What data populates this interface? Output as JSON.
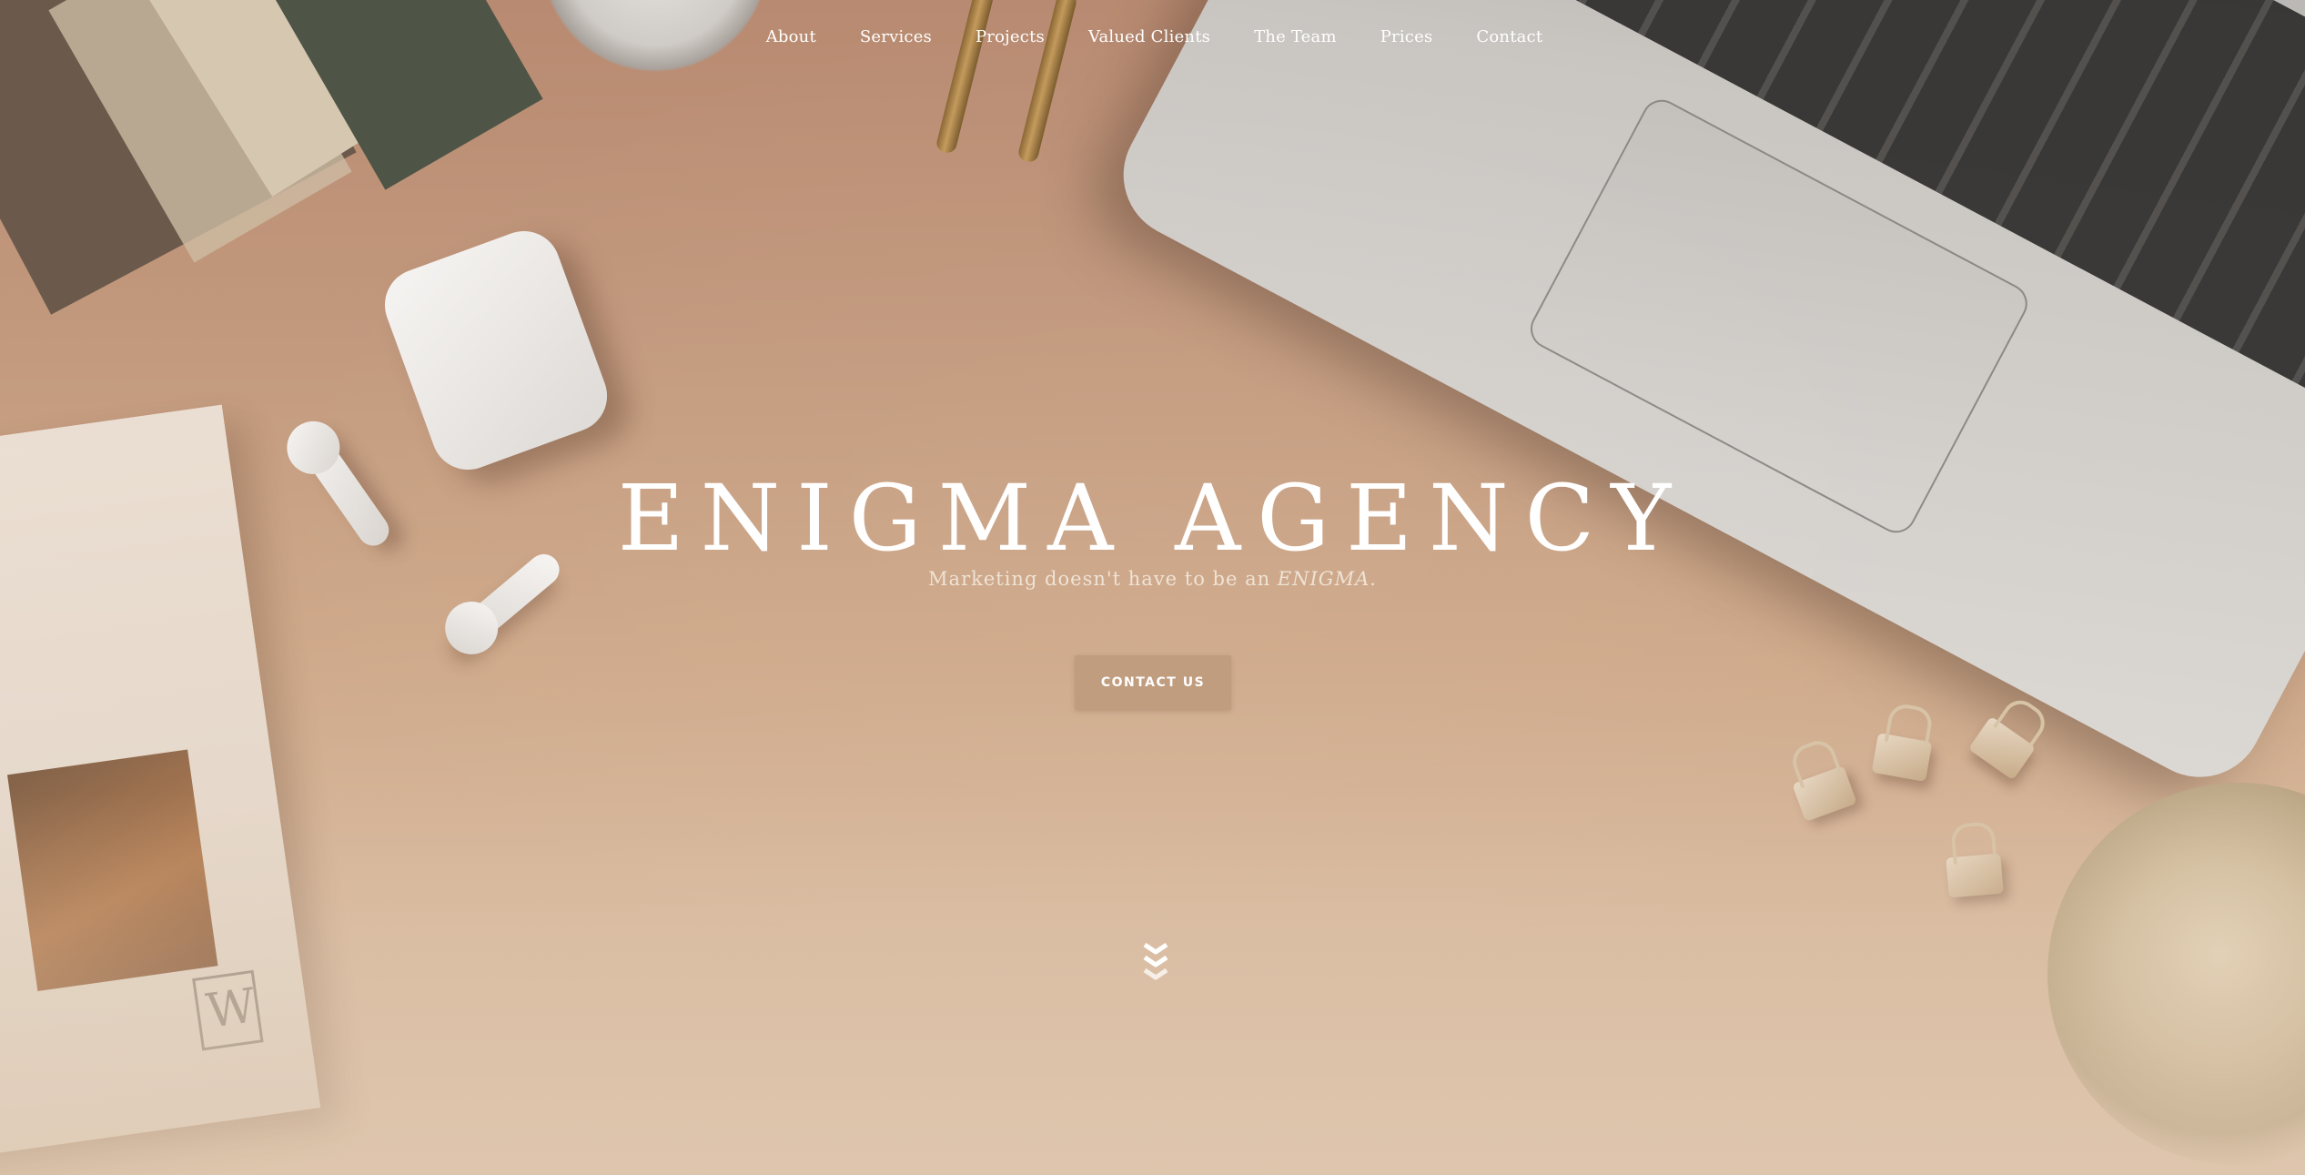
{
  "nav": {
    "items": [
      {
        "label": "About"
      },
      {
        "label": "Services"
      },
      {
        "label": "Projects"
      },
      {
        "label": "Valued Clients"
      },
      {
        "label": "The Team"
      },
      {
        "label": "Prices"
      },
      {
        "label": "Contact"
      }
    ]
  },
  "hero": {
    "title": "ENIGMA AGENCY",
    "tagline_prefix": "Marketing doesn't have to be an ",
    "tagline_emphasis": "ENIGMA",
    "tagline_suffix": ".",
    "cta_label": "CONTACT US",
    "scroll_icon": "triple-chevron-down-icon"
  },
  "colors": {
    "background_top": "#b88a71",
    "background_bottom": "#ddc3ab",
    "cta_background": "#c19d7f",
    "text": "#ffffff"
  }
}
